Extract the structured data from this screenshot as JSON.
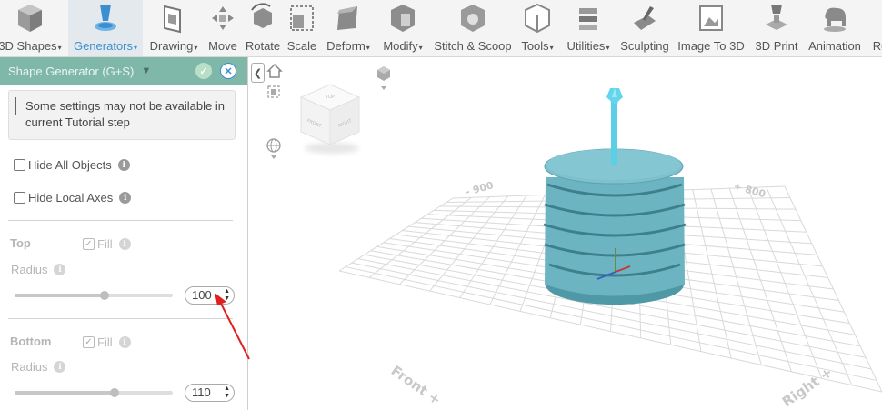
{
  "toolbar": {
    "items": [
      {
        "label": "3D Shapes",
        "caret": true,
        "icon": "cube-icon"
      },
      {
        "label": "Generators",
        "caret": true,
        "icon": "generator-icon",
        "active": true
      },
      {
        "label": "Drawing",
        "caret": true,
        "icon": "drawing-icon"
      },
      {
        "label": "Move",
        "caret": false,
        "icon": "move-icon"
      },
      {
        "label": "Rotate",
        "caret": false,
        "icon": "rotate-icon"
      },
      {
        "label": "Scale",
        "caret": false,
        "icon": "scale-icon"
      },
      {
        "label": "Deform",
        "caret": true,
        "icon": "deform-icon"
      },
      {
        "label": "Modify",
        "caret": true,
        "icon": "modify-icon"
      },
      {
        "label": "Stitch & Scoop",
        "caret": false,
        "icon": "stitch-scoop-icon"
      },
      {
        "label": "Tools",
        "caret": true,
        "icon": "tools-icon"
      },
      {
        "label": "Utilities",
        "caret": true,
        "icon": "utilities-icon"
      },
      {
        "label": "Sculpting",
        "caret": false,
        "icon": "sculpting-icon"
      },
      {
        "label": "Image To 3D",
        "caret": false,
        "icon": "image-to-3d-icon"
      },
      {
        "label": "3D Print",
        "caret": false,
        "icon": "3d-print-icon"
      },
      {
        "label": "Animation",
        "caret": false,
        "icon": "animation-icon"
      },
      {
        "label": "Re",
        "caret": false,
        "icon": "render-icon"
      }
    ],
    "caret_glyph": "▾"
  },
  "panel": {
    "title": "Shape Generator (G+S)",
    "dropdown_glyph": "▼",
    "ok_glyph": "✓",
    "close_glyph": "✕",
    "notice": "Some settings may not be available in current Tutorial step",
    "hide_all_objects": "Hide All Objects",
    "hide_local_axes": "Hide Local Axes",
    "info_glyph": "i",
    "top": {
      "title": "Top",
      "fill_label": "Fill",
      "fill_checked": true,
      "radius_label": "Radius",
      "radius_value": "100",
      "slider_fraction": 0.57
    },
    "bottom": {
      "title": "Bottom",
      "fill_label": "Fill",
      "fill_checked": true,
      "radius_label": "Radius",
      "radius_value": "110",
      "slider_fraction": 0.63
    }
  },
  "viewport": {
    "nav_cube_faces": {
      "top": "TOP",
      "front": "FRONT",
      "right": "RIGHT"
    },
    "axis_labels": {
      "back_left": "- 900",
      "back_right": "+ 800",
      "front": "Front +",
      "right": "Right +"
    },
    "colors": {
      "shape": "#6bb3c0",
      "shape_dark": "#4d97a6",
      "handle": "#5fd0e8",
      "accent": "#3b8fd0",
      "panel_header": "#7fb8a8",
      "arrow": "#e02020"
    }
  }
}
